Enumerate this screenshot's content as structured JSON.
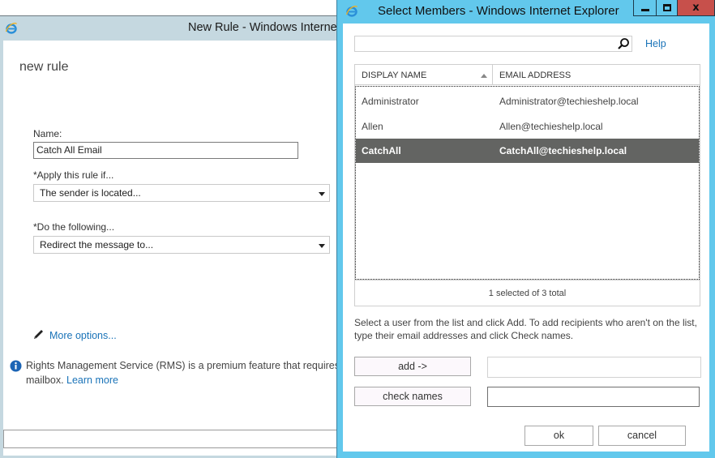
{
  "back_window": {
    "title": "New Rule - Windows Internet Explorer",
    "page_title": "new rule",
    "name_label": "Name:",
    "name_value": "Catch All Email",
    "apply_label": "*Apply this rule if...",
    "apply_value": "The sender is located...",
    "do_label": "*Do the following...",
    "do_value": "Redirect the message to...",
    "more_options": "More options...",
    "info_text": "Rights Management Service (RMS) is a premium feature that requires an",
    "info_text_line2": "mailbox.",
    "learn_more": "Learn more"
  },
  "dialog": {
    "title": "Select Members - Windows Internet Explorer",
    "window_buttons": {
      "minimize": "minimize",
      "maximize": "maximize",
      "close": "x"
    },
    "search": {
      "value": "",
      "placeholder": ""
    },
    "help_label": "Help",
    "columns": [
      "DISPLAY NAME",
      "EMAIL ADDRESS"
    ],
    "rows": [
      {
        "name": "Administrator",
        "email": "Administrator@techieshelp.local",
        "selected": false
      },
      {
        "name": "Allen",
        "email": "Allen@techieshelp.local",
        "selected": false
      },
      {
        "name": "CatchAll",
        "email": "CatchAll@techieshelp.local",
        "selected": true
      }
    ],
    "status": "1 selected of 3 total",
    "instructions_line1": "Select a user from the list and click Add. To add recipients who aren't on the list,",
    "instructions_line2": "type their email addresses and click Check names.",
    "add_label": "add ->",
    "add_field_value": "",
    "check_names_label": "check names",
    "check_field_value": "",
    "ok_label": "ok",
    "cancel_label": "cancel"
  },
  "colors": {
    "dialog_frame": "#62c8ec",
    "back_frame": "#c5d8e0",
    "selected_row": "#636462",
    "link": "#1a73b8",
    "close_button": "#c7504b"
  }
}
